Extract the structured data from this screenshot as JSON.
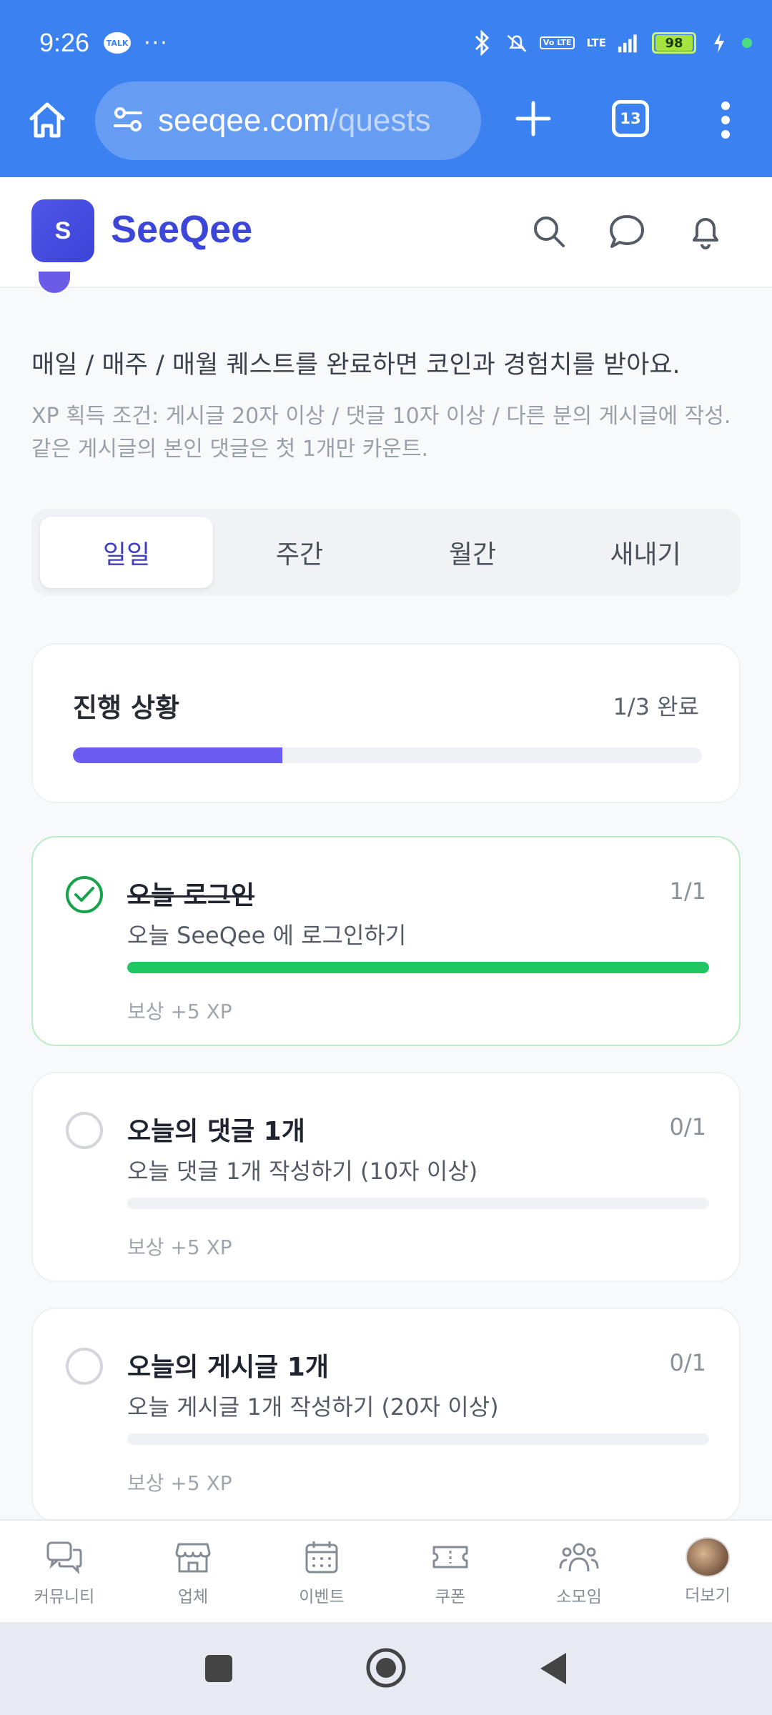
{
  "status_bar": {
    "time": "9:26",
    "talk_badge": "TALK",
    "more": "···",
    "volte": "Vo LTE",
    "lte": "LTE",
    "battery": "98"
  },
  "browser": {
    "url_domain": "seeqee.com",
    "url_path": "/quests",
    "tab_count": "13"
  },
  "app": {
    "logo_letter": "S",
    "brand": "SeeQee"
  },
  "intro": {
    "description": "매일 / 매주 / 매월 퀘스트를 완료하면 코인과 경험치를 받아요.",
    "note_line1": "XP 획득 조건: 게시글 20자 이상 / 댓글 10자 이상 / 다른 분의 게시글에 작성.",
    "note_line2": "같은 게시글의 본인 댓글은 첫 1개만 카운트."
  },
  "tabs": [
    {
      "label": "일일",
      "active": true
    },
    {
      "label": "주간",
      "active": false
    },
    {
      "label": "월간",
      "active": false
    },
    {
      "label": "새내기",
      "active": false
    }
  ],
  "progress": {
    "title": "진행 상황",
    "count_text": "1/3 완료",
    "fraction": 0.333
  },
  "quests": [
    {
      "title": "오늘 로그인",
      "count": "1/1",
      "description": "오늘 SeeQee 에 로그인하기",
      "reward": "보상 +5 XP",
      "done": true,
      "progress": 1.0
    },
    {
      "title": "오늘의 댓글 1개",
      "count": "0/1",
      "description": "오늘 댓글 1개 작성하기 (10자 이상)",
      "reward": "보상 +5 XP",
      "done": false,
      "progress": 0
    },
    {
      "title": "오늘의 게시글 1개",
      "count": "0/1",
      "description": "오늘 게시글 1개 작성하기 (20자 이상)",
      "reward": "보상 +5 XP",
      "done": false,
      "progress": 0
    }
  ],
  "bottom_nav": [
    {
      "label": "커뮤니티",
      "icon": "chat-bubbles-icon"
    },
    {
      "label": "업체",
      "icon": "store-icon"
    },
    {
      "label": "이벤트",
      "icon": "calendar-icon"
    },
    {
      "label": "쿠폰",
      "icon": "ticket-icon"
    },
    {
      "label": "소모임",
      "icon": "group-icon"
    },
    {
      "label": "더보기",
      "icon": "avatar"
    }
  ],
  "colors": {
    "chrome": "#3b82f0",
    "brand": "#3c46d8",
    "progress_fill": "#6a5cf0",
    "done_green": "#1ec762"
  }
}
